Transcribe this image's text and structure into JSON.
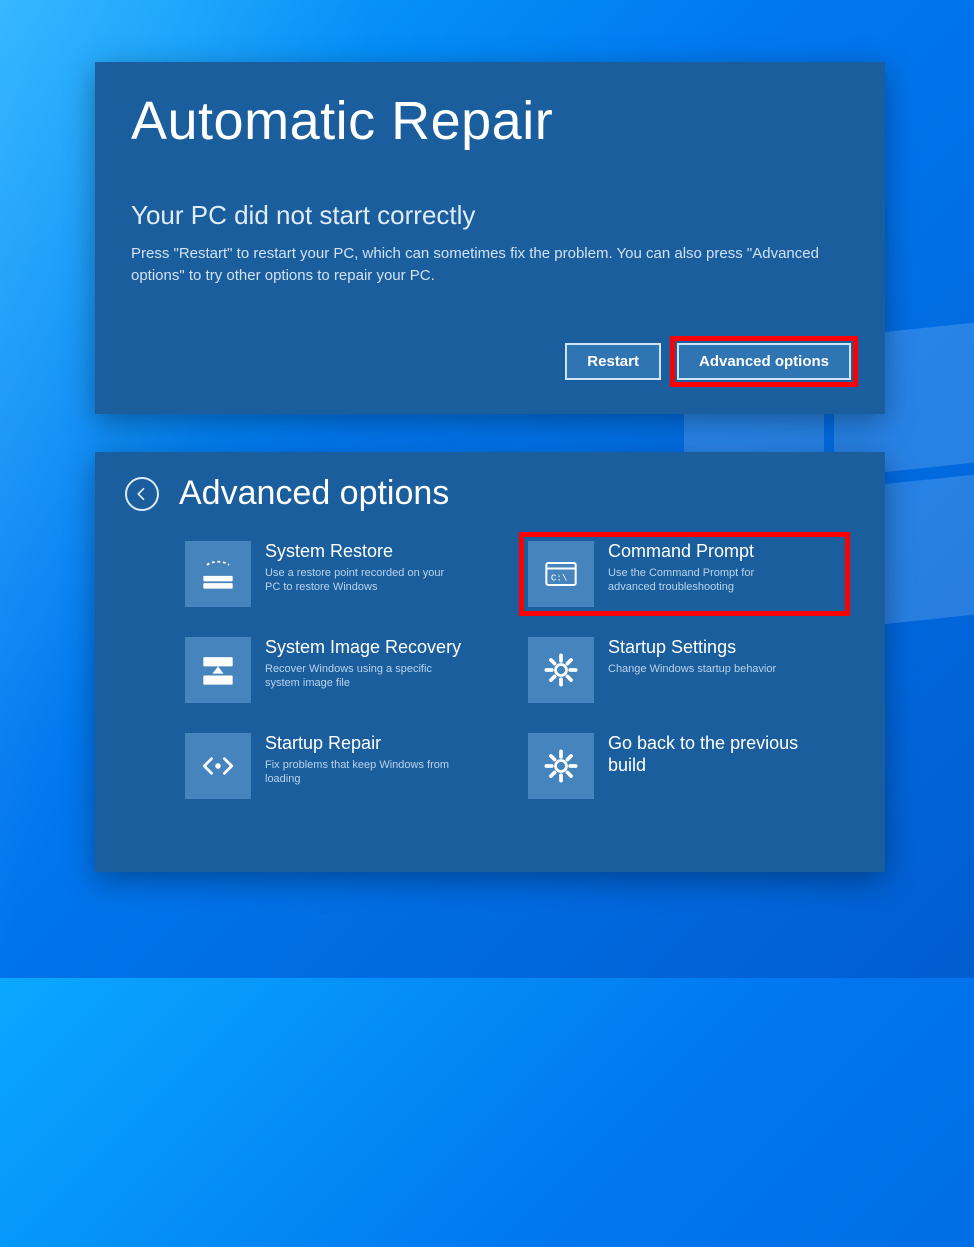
{
  "colors": {
    "accent": "#1b5e9e",
    "highlight": "#ff0000"
  },
  "top_panel": {
    "title": "Automatic Repair",
    "subtitle": "Your PC did not start correctly",
    "body": "Press \"Restart\" to restart your PC, which can sometimes fix the problem. You can also press \"Advanced options\" to try other options to repair your PC.",
    "buttons": {
      "restart": "Restart",
      "advanced": "Advanced options"
    }
  },
  "bottom_panel": {
    "title": "Advanced options",
    "tiles": [
      {
        "id": "system-restore",
        "icon": "restore-icon",
        "title": "System Restore",
        "desc": "Use a restore point recorded on your PC to restore Windows"
      },
      {
        "id": "command-prompt",
        "icon": "cmd-icon",
        "title": "Command Prompt",
        "desc": "Use the Command Prompt for advanced troubleshooting"
      },
      {
        "id": "system-image-recovery",
        "icon": "image-recovery-icon",
        "title": "System Image Recovery",
        "desc": "Recover Windows using a specific system image file"
      },
      {
        "id": "startup-settings",
        "icon": "gear-icon",
        "title": "Startup Settings",
        "desc": "Change Windows startup behavior"
      },
      {
        "id": "startup-repair",
        "icon": "code-icon",
        "title": "Startup Repair",
        "desc": "Fix problems that keep Windows from loading"
      },
      {
        "id": "go-back",
        "icon": "gear-icon",
        "title": "Go back to the previous build",
        "desc": ""
      }
    ]
  }
}
